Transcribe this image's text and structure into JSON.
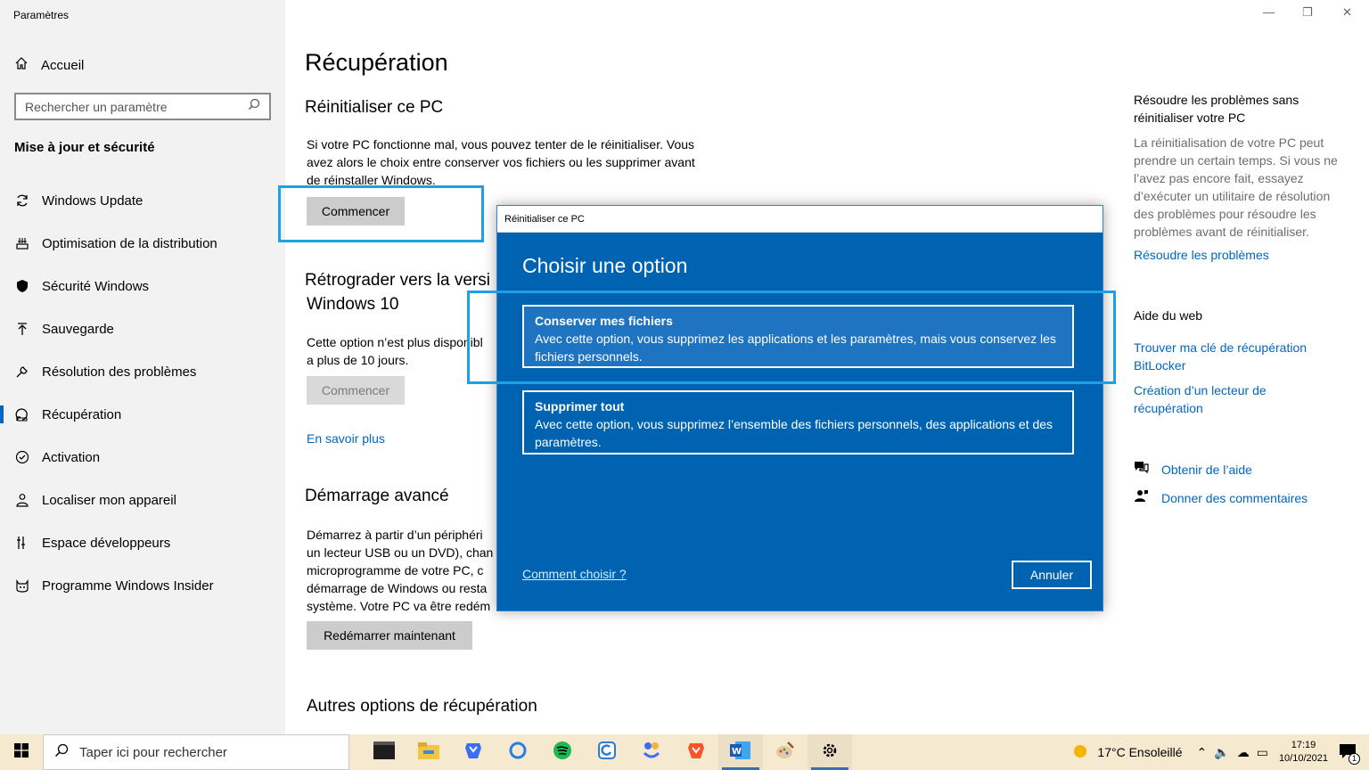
{
  "window": {
    "app_title": "Paramètres"
  },
  "sidebar": {
    "home": "Accueil",
    "search_placeholder": "Rechercher un paramètre",
    "section": "Mise à jour et sécurité",
    "items": [
      {
        "label": "Windows Update",
        "icon": "sync-icon"
      },
      {
        "label": "Optimisation de la distribution",
        "icon": "delivery-icon"
      },
      {
        "label": "Sécurité Windows",
        "icon": "shield-icon"
      },
      {
        "label": "Sauvegarde",
        "icon": "backup-arrow-icon"
      },
      {
        "label": "Résolution des problèmes",
        "icon": "wrench-icon"
      },
      {
        "label": "Récupération",
        "icon": "recovery-icon",
        "active": true
      },
      {
        "label": "Activation",
        "icon": "check-circle-icon"
      },
      {
        "label": "Localiser mon appareil",
        "icon": "person-location-icon"
      },
      {
        "label": "Espace développeurs",
        "icon": "developer-icon"
      },
      {
        "label": "Programme Windows Insider",
        "icon": "insider-cat-icon"
      }
    ]
  },
  "main": {
    "title": "Récupération",
    "reset": {
      "heading": "Réinitialiser ce PC",
      "text": "Si votre PC fonctionne mal, vous pouvez tenter de le réinitialiser. Vous avez alors le choix entre conserver vos fichiers ou les supprimer avant de réinstaller Windows.",
      "button": "Commencer"
    },
    "rollback": {
      "heading_line1": "Rétrograder vers la versi",
      "heading_line2": "Windows 10",
      "text_line1": "Cette option n’est plus disponibl",
      "text_line2": "a plus de 10 jours.",
      "button": "Commencer"
    },
    "learn_more": "En savoir plus",
    "advanced": {
      "heading": "Démarrage avancé",
      "lines": [
        "Démarrez à partir d’un périphéri",
        "un lecteur USB ou un DVD), chan",
        "microprogramme de votre PC, c",
        "démarrage de Windows ou resta",
        "système. Votre PC va être redém"
      ],
      "button": "Redémarrer maintenant"
    },
    "other": {
      "heading": "Autres options de récupération"
    }
  },
  "right": {
    "troubleshoot_title": "Résoudre les problèmes sans réinitialiser votre PC",
    "troubleshoot_text": "La réinitialisation de votre PC peut prendre un certain temps. Si vous ne l’avez pas encore fait, essayez d’exécuter un utilitaire de résolution des problèmes pour résoudre les problèmes avant de réinitialiser.",
    "troubleshoot_link": "Résoudre les problèmes",
    "web_help_title": "Aide du web",
    "web_links": [
      "Trouver ma clé de récupération BitLocker",
      "Création d’un lecteur de récupération"
    ],
    "get_help": "Obtenir de l’aide",
    "feedback": "Donner des commentaires"
  },
  "dialog": {
    "title": "Réinitialiser ce PC",
    "heading": "Choisir une option",
    "option1_title": "Conserver mes fichiers",
    "option1_text": "Avec cette option, vous supprimez les applications et les paramètres, mais vous conservez les fichiers personnels.",
    "option2_title": "Supprimer tout",
    "option2_text": "Avec cette option, vous supprimez l’ensemble des fichiers personnels, des applications et des paramètres.",
    "link": "Comment choisir ?",
    "cancel": "Annuler"
  },
  "taskbar": {
    "search_placeholder": "Taper ici pour rechercher",
    "weather": "17°C  Ensoleillé",
    "time": "17:19",
    "date": "10/10/2021",
    "notifications": "1",
    "apps": [
      "terminal-icon",
      "file-explorer-icon",
      "brave-beta-icon",
      "cortana-icon",
      "spotify-icon",
      "onenote-icon",
      "app-icon",
      "brave-icon",
      "word-icon",
      "paint-icon",
      "settings-icon"
    ]
  },
  "colors": {
    "accent": "#0067c0",
    "dialog_bg": "#0063b1",
    "highlight": "#1ea0e6",
    "taskbar": "#f5e9d0"
  }
}
